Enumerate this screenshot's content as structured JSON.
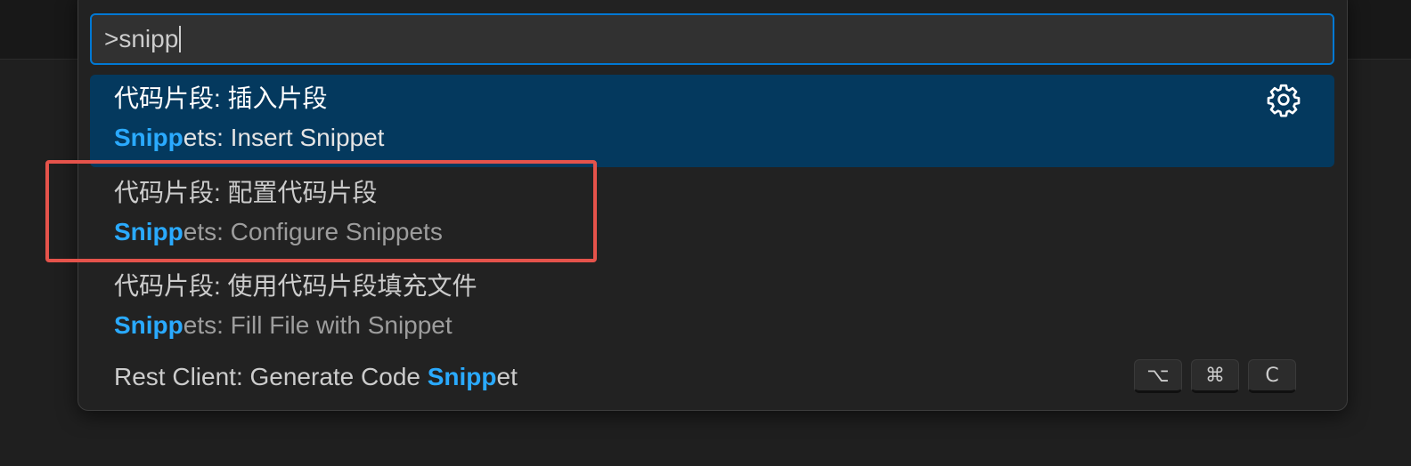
{
  "command_palette": {
    "input_value": ">snipp",
    "items": [
      {
        "title": "代码片段: 插入片段",
        "sub_match": "Snipp",
        "sub_rest": "ets: Insert Snippet",
        "selected": true
      },
      {
        "title": "代码片段: 配置代码片段",
        "sub_match": "Snipp",
        "sub_rest": "ets: Configure Snippets"
      },
      {
        "title": "代码片段: 使用代码片段填充文件",
        "sub_match": "Snipp",
        "sub_rest": "ets: Fill File with Snippet"
      },
      {
        "title_prefix": "Rest Client: Generate Code ",
        "title_match": "Snipp",
        "title_rest": "et",
        "keybinding": [
          "⌥",
          "⌘",
          "C"
        ]
      }
    ]
  },
  "icons": {
    "gear": "gear-icon"
  },
  "colors": {
    "highlight": "#2aaaff",
    "selection": "#04395e",
    "focus_border": "#0078d4",
    "annotation": "#e5534b"
  }
}
